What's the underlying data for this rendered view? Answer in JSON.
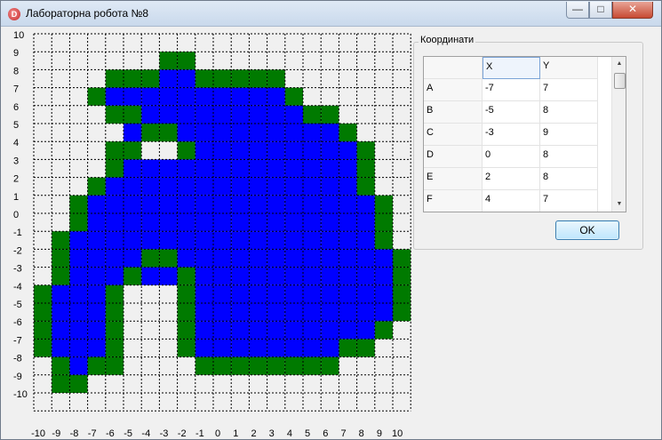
{
  "window": {
    "title": "Лабораторна робота №8",
    "app_icon_letter": "D",
    "controls": {
      "minimize": "—",
      "maximize": "□",
      "close": "✕"
    }
  },
  "grid": {
    "x_min": -10,
    "x_max": 10,
    "y_min": -10,
    "y_max": 10,
    "x_labels": [
      "-10",
      "-9",
      "-8",
      "-7",
      "-6",
      "-5",
      "-4",
      "-3",
      "-2",
      "-1",
      "0",
      "1",
      "2",
      "3",
      "4",
      "5",
      "6",
      "7",
      "8",
      "9",
      "10"
    ],
    "y_labels": [
      "10",
      "9",
      "8",
      "7",
      "6",
      "5",
      "4",
      "3",
      "2",
      "1",
      "0",
      "-1",
      "-2",
      "-3",
      "-4",
      "-5",
      "-6",
      "-7",
      "-8",
      "-9",
      "-10"
    ],
    "colors": {
      "fill": "#0000ff",
      "border": "#007a00",
      "background": "#f0f0f0",
      "grid_line": "#000000"
    },
    "green_rows": {
      "9": [
        [
          -3,
          -2
        ]
      ],
      "8": [
        [
          -6,
          -4
        ],
        [
          -1,
          3
        ]
      ],
      "7": [
        [
          -7,
          -7
        ],
        [
          4,
          4
        ]
      ],
      "6": [
        [
          -6,
          -5
        ],
        [
          5,
          6
        ]
      ],
      "5": [
        [
          -4,
          -3
        ],
        [
          7,
          7
        ]
      ],
      "4": [
        [
          -6,
          -5
        ],
        [
          -2,
          -2
        ],
        [
          8,
          8
        ]
      ],
      "3": [
        [
          -6,
          -6
        ],
        [
          8,
          8
        ]
      ],
      "2": [
        [
          -7,
          -7
        ],
        [
          8,
          8
        ]
      ],
      "1": [
        [
          -8,
          -8
        ],
        [
          9,
          9
        ]
      ],
      "0": [
        [
          -8,
          -8
        ],
        [
          9,
          9
        ]
      ],
      "-1": [
        [
          -9,
          -9
        ],
        [
          9,
          9
        ]
      ],
      "-2": [
        [
          -9,
          -9
        ],
        [
          -4,
          -3
        ],
        [
          10,
          10
        ]
      ],
      "-3": [
        [
          -9,
          -9
        ],
        [
          -5,
          -5
        ],
        [
          -2,
          -2
        ],
        [
          10,
          10
        ]
      ],
      "-4": [
        [
          -10,
          -10
        ],
        [
          -6,
          -6
        ],
        [
          -2,
          -2
        ],
        [
          10,
          10
        ]
      ],
      "-5": [
        [
          -10,
          -10
        ],
        [
          -6,
          -6
        ],
        [
          -2,
          -2
        ],
        [
          10,
          10
        ]
      ],
      "-6": [
        [
          -10,
          -10
        ],
        [
          -6,
          -6
        ],
        [
          -2,
          -2
        ],
        [
          9,
          9
        ]
      ],
      "-7": [
        [
          -10,
          -10
        ],
        [
          -6,
          -6
        ],
        [
          -2,
          -2
        ],
        [
          7,
          8
        ]
      ],
      "-8": [
        [
          -9,
          -9
        ],
        [
          -7,
          -6
        ],
        [
          -1,
          6
        ]
      ],
      "-9": [
        [
          -9,
          -8
        ]
      ]
    },
    "blue_rows": {
      "8": [
        [
          -3,
          -2
        ]
      ],
      "7": [
        [
          -6,
          3
        ]
      ],
      "6": [
        [
          -4,
          4
        ]
      ],
      "5": [
        [
          -5,
          -5
        ],
        [
          -2,
          6
        ]
      ],
      "4": [
        [
          -1,
          7
        ]
      ],
      "3": [
        [
          -5,
          7
        ]
      ],
      "2": [
        [
          -6,
          7
        ]
      ],
      "1": [
        [
          -7,
          8
        ]
      ],
      "0": [
        [
          -7,
          8
        ]
      ],
      "-1": [
        [
          -8,
          8
        ]
      ],
      "-2": [
        [
          -8,
          -5
        ],
        [
          -2,
          9
        ]
      ],
      "-3": [
        [
          -8,
          -6
        ],
        [
          -4,
          -3
        ],
        [
          -1,
          9
        ]
      ],
      "-4": [
        [
          -9,
          -7
        ],
        [
          -1,
          9
        ]
      ],
      "-5": [
        [
          -9,
          -7
        ],
        [
          -1,
          9
        ]
      ],
      "-6": [
        [
          -9,
          -7
        ],
        [
          -1,
          8
        ]
      ],
      "-7": [
        [
          -9,
          -7
        ],
        [
          -1,
          6
        ]
      ],
      "-8": [
        [
          -8,
          -8
        ]
      ]
    }
  },
  "coords_panel": {
    "title": "Координати",
    "headers": {
      "corner": "",
      "x": "X",
      "y": "Y"
    },
    "rows": [
      {
        "name": "A",
        "x": "-7",
        "y": "7"
      },
      {
        "name": "B",
        "x": "-5",
        "y": "8"
      },
      {
        "name": "C",
        "x": "-3",
        "y": "9"
      },
      {
        "name": "D",
        "x": "0",
        "y": "8"
      },
      {
        "name": "E",
        "x": "2",
        "y": "8"
      },
      {
        "name": "F",
        "x": "4",
        "y": "7"
      }
    ],
    "scroll_up_icon": "▲",
    "scroll_down_icon": "▼"
  },
  "ok_button": {
    "label": "OK"
  }
}
